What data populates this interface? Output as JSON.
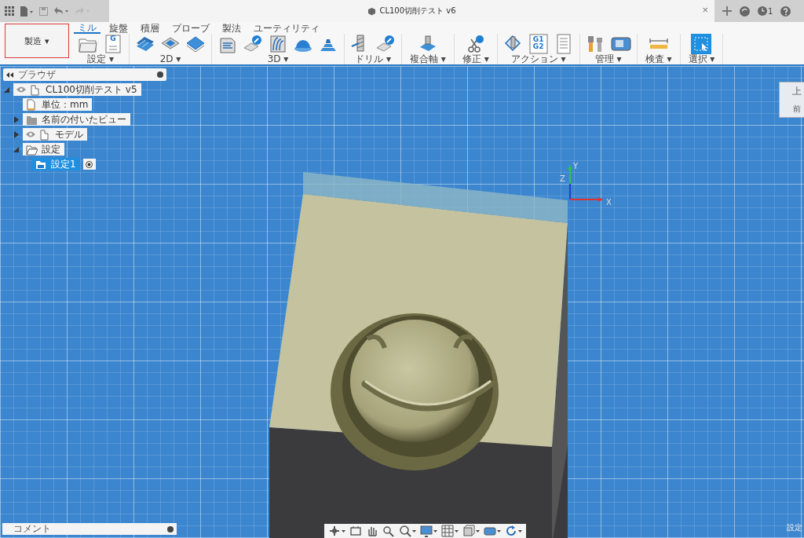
{
  "title_bar": {
    "title": "CL100切削テスト v6",
    "close": "×",
    "job_count": "1"
  },
  "workspace": {
    "label": "製造",
    "caret": "▾"
  },
  "tabs": [
    {
      "label": "ミル",
      "selected": true
    },
    {
      "label": "旋盤",
      "selected": false
    },
    {
      "label": "積層",
      "selected": false
    },
    {
      "label": "プローブ",
      "selected": false
    },
    {
      "label": "製法",
      "selected": false
    },
    {
      "label": "ユーティリティ",
      "selected": false
    }
  ],
  "groups": [
    {
      "label": "設定 ▾",
      "tools": [
        {
          "kind": "folder"
        },
        {
          "kind": "setup",
          "text": "G"
        }
      ]
    },
    {
      "label": "2D ▾",
      "tools": [
        {
          "kind": "adaptive"
        },
        {
          "kind": "pocket"
        },
        {
          "kind": "face"
        }
      ]
    },
    {
      "label": "3D ▾",
      "tools": [
        {
          "kind": "box"
        },
        {
          "kind": "probe"
        },
        {
          "kind": "contour"
        },
        {
          "kind": "dome"
        },
        {
          "kind": "spiral"
        }
      ]
    },
    {
      "label": "ドリル ▾",
      "tools": [
        {
          "kind": "drill"
        },
        {
          "kind": "probe"
        }
      ]
    },
    {
      "label": "複合軸 ▾",
      "tools": [
        {
          "kind": "multiaxis"
        }
      ]
    },
    {
      "label": "修正 ▾",
      "tools": [
        {
          "kind": "scissors"
        }
      ]
    },
    {
      "label": "アクション ▾",
      "tools": [
        {
          "kind": "post"
        },
        {
          "kind": "gcode",
          "text": "G1 G2"
        },
        {
          "kind": "sheet"
        }
      ]
    },
    {
      "label": "管理 ▾",
      "tools": [
        {
          "kind": "library"
        },
        {
          "kind": "machine"
        }
      ]
    },
    {
      "label": "検査 ▾",
      "tools": [
        {
          "kind": "ruler"
        }
      ]
    },
    {
      "label": "選択 ▾",
      "tools": [
        {
          "kind": "select"
        }
      ]
    }
  ],
  "browser": {
    "title": "ブラウザ",
    "tree": [
      {
        "label": "CL100切削テスト v5",
        "kind": "component",
        "eye": true,
        "expanded": true,
        "selected": false,
        "children": [
          {
            "label": "単位：mm",
            "kind": "document",
            "eye": false,
            "selected": false
          },
          {
            "label": "名前の付いたビュー",
            "kind": "folder",
            "eye": false,
            "expanded": false,
            "selected": false
          },
          {
            "label": "モデル",
            "kind": "component",
            "eye": true,
            "expanded": false,
            "selected": false
          },
          {
            "label": "設定",
            "kind": "folder-open",
            "eye": false,
            "expanded": true,
            "selected": false,
            "children": [
              {
                "label": "設定1",
                "kind": "setup",
                "eye": false,
                "selected": true,
                "active": true
              }
            ]
          }
        ]
      }
    ]
  },
  "view_cube": {
    "top": "上",
    "front": "前"
  },
  "axes": {
    "x": "X",
    "y": "Y",
    "z": "Z"
  },
  "nav_bar": [
    {
      "kind": "orbit",
      "caret": true
    },
    {
      "kind": "look",
      "caret": false
    },
    {
      "kind": "pan",
      "caret": false
    },
    {
      "kind": "zoom",
      "caret": false
    },
    {
      "kind": "fit",
      "caret": true
    },
    {
      "kind": "display",
      "caret": true
    },
    {
      "kind": "grid",
      "caret": true
    },
    {
      "kind": "viewports",
      "caret": true
    },
    {
      "kind": "camera",
      "caret": true
    },
    {
      "kind": "refresh",
      "caret": true
    }
  ],
  "comments": {
    "title": "コメント"
  },
  "status_text": "設定"
}
